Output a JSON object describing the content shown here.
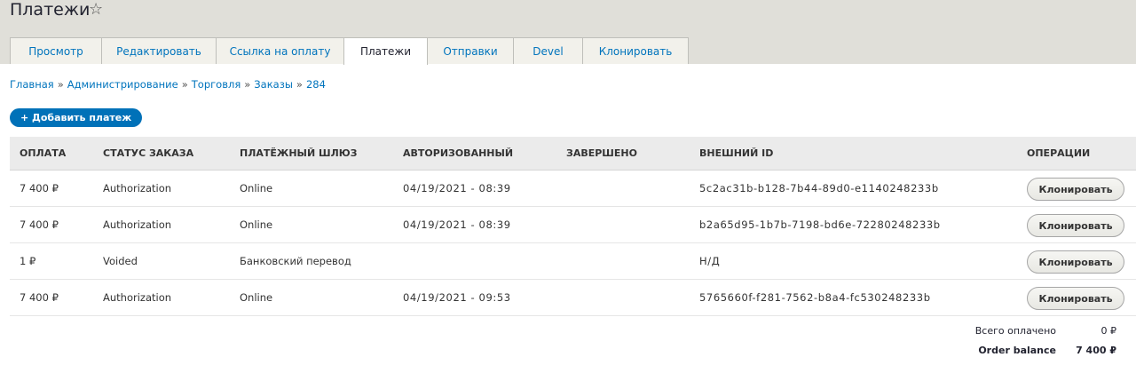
{
  "header": {
    "title": "Платежи",
    "star_icon": "☆"
  },
  "tabs": [
    {
      "label": "Просмотр"
    },
    {
      "label": "Редактировать"
    },
    {
      "label": "Ссылка на оплату"
    },
    {
      "label": "Платежи",
      "active": true
    },
    {
      "label": "Отправки"
    },
    {
      "label": "Devel"
    },
    {
      "label": "Клонировать"
    }
  ],
  "breadcrumb": {
    "items": [
      "Главная",
      "Администрирование",
      "Торговля",
      "Заказы",
      "284"
    ],
    "separator": "»"
  },
  "add_payment_label": "+ Добавить платеж",
  "table": {
    "columns": [
      "ОПЛАТА",
      "СТАТУС ЗАКАЗА",
      "ПЛАТЁЖНЫЙ ШЛЮЗ",
      "АВТОРИЗОВАННЫЙ",
      "ЗАВЕРШЕНО",
      "ВНЕШНИЙ ID",
      "ОПЕРАЦИИ"
    ],
    "rows": [
      {
        "amount": "7 400 ₽",
        "status": "Authorization",
        "gateway": "Online",
        "authorized": "04/19/2021 - 08:39",
        "completed": "",
        "external_id": "5c2ac31b-b128-7b44-89d0-e1140248233b",
        "operation": "Клонировать"
      },
      {
        "amount": "7 400 ₽",
        "status": "Authorization",
        "gateway": "Online",
        "authorized": "04/19/2021 - 08:39",
        "completed": "",
        "external_id": "b2a65d95-1b7b-7198-bd6e-72280248233b",
        "operation": "Клонировать"
      },
      {
        "amount": "1 ₽",
        "status": "Voided",
        "gateway": "Банковский перевод",
        "authorized": "",
        "completed": "",
        "external_id": "Н/Д",
        "operation": "Клонировать"
      },
      {
        "amount": "7 400 ₽",
        "status": "Authorization",
        "gateway": "Online",
        "authorized": "04/19/2021 - 09:53",
        "completed": "",
        "external_id": "5765660f-f281-7562-b8a4-fc530248233b",
        "operation": "Клонировать"
      }
    ]
  },
  "totals": {
    "paid_label": "Всего оплачено",
    "paid_value": "0 ₽",
    "balance_label": "Order balance",
    "balance_value": "7 400 ₽"
  }
}
